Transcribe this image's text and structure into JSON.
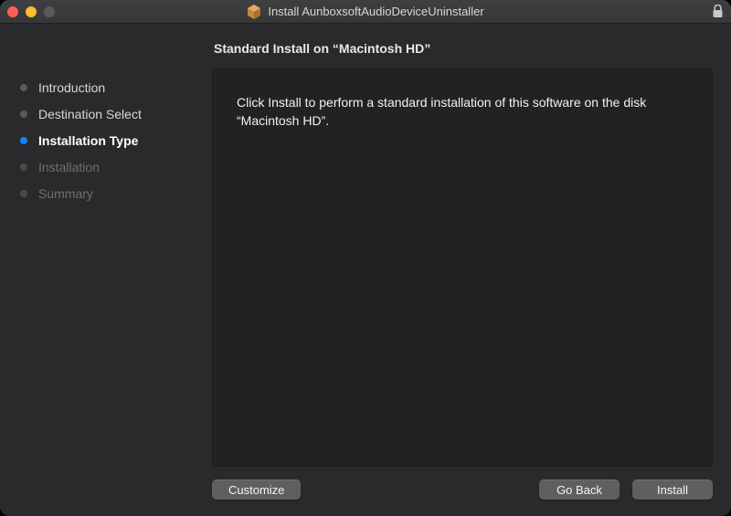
{
  "window": {
    "title": "Install AunboxsoftAudioDeviceUninstaller"
  },
  "sidebar": {
    "steps": [
      {
        "label": "Introduction",
        "state": "done"
      },
      {
        "label": "Destination Select",
        "state": "done"
      },
      {
        "label": "Installation Type",
        "state": "active"
      },
      {
        "label": "Installation",
        "state": "pending"
      },
      {
        "label": "Summary",
        "state": "pending"
      }
    ]
  },
  "main": {
    "heading": "Standard Install on “Macintosh HD”",
    "body_text": "Click Install to perform a standard installation of this software on the disk “Macintosh HD”."
  },
  "buttons": {
    "customize": "Customize",
    "go_back": "Go Back",
    "install": "Install"
  }
}
